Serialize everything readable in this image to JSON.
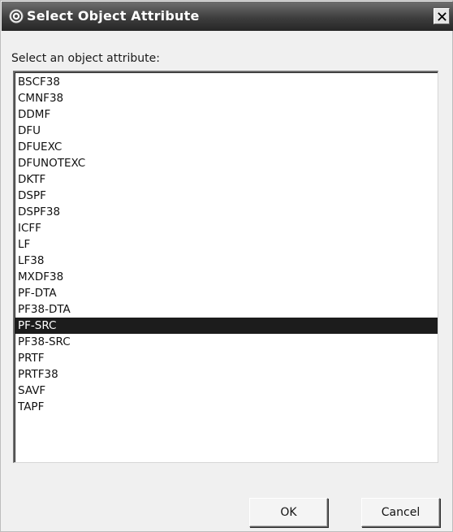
{
  "window": {
    "title": "Select Object Attribute",
    "app_icon": "dialog-app-icon",
    "close_icon": "close-icon"
  },
  "prompt": "Select an object attribute:",
  "list": {
    "items": [
      "BSCF38",
      "CMNF38",
      "DDMF",
      "DFU",
      "DFUEXC",
      "DFUNOTEXC",
      "DKTF",
      "DSPF",
      "DSPF38",
      "ICFF",
      "LF",
      "LF38",
      "MXDF38",
      "PF-DTA",
      "PF38-DTA",
      "PF-SRC",
      "PF38-SRC",
      "PRTF",
      "PRTF38",
      "SAVF",
      "TAPF"
    ],
    "selected": "PF-SRC"
  },
  "buttons": {
    "ok_label": "OK",
    "cancel_label": "Cancel"
  },
  "colors": {
    "titlebar": "#3e3e3e",
    "selection_background": "#1c1c1c",
    "selection_text": "#ffffff"
  }
}
